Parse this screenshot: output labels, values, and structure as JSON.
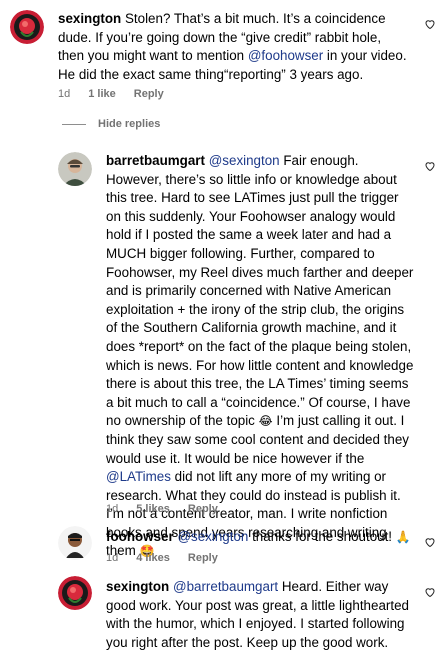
{
  "comments": [
    {
      "username": "sexington",
      "parts": [
        {
          "t": "Stolen? That’s a bit much. It’s a coincidence dude. If you’re going down the “give credit” rabbit hole, then you might want to mention "
        },
        {
          "m": "@foohowser"
        },
        {
          "t": " in your video. He did the exact same thing“reporting” 3 years ago."
        }
      ],
      "time": "1d",
      "likes": "1 like",
      "reply": "Reply"
    },
    {
      "username": "barretbaumgart",
      "parts": [
        {
          "m": "@sexington"
        },
        {
          "t": " Fair enough. However, there’s so little info or knowledge about this tree. Hard to see LATimes just pull the trigger on this suddenly. Your Foohowser analogy would hold if I posted the same a week later and had a MUCH bigger following. Further, compared to Foohowser, my Reel dives much farther and deeper and is primarily concerned with Native American exploitation + the irony of the strip club, the origins of the Southern California growth machine, and it does *report* on the fact of the plaque being stolen, which is news. For how little content and knowledge there is about this tree, the LA Times’ timing seems a bit much to call a “coincidence.” Of course, I have no ownership of the topic "
        },
        {
          "e": "😂"
        },
        {
          "t": " I’m just calling it out. I think they saw some cool content and decided they would use it. It would be nice however if the "
        },
        {
          "m": "@LATimes"
        },
        {
          "t": " did not lift any more of my writing or research. What they could do instead is publish it. I’m not a content creator, man. I write nonfiction books and spend years researching and writing them "
        },
        {
          "e": "🤩"
        }
      ],
      "time": "1d",
      "likes": "5 likes",
      "reply": "Reply"
    },
    {
      "username": "foohowser",
      "parts": [
        {
          "m": "@sexington"
        },
        {
          "t": " thanks for the shoutout! "
        },
        {
          "e": "🙏"
        }
      ],
      "time": "1d",
      "likes": "4 likes",
      "reply": "Reply"
    },
    {
      "username": "sexington",
      "parts": [
        {
          "m": "@barretbaumgart"
        },
        {
          "t": " Heard. Either way good work. Your post was great, a little lighthearted with the humor, which I enjoyed. I started following you right after the post. Keep up the good work."
        }
      ],
      "time": "",
      "likes": "",
      "reply": ""
    }
  ],
  "hide_replies": "Hide replies"
}
